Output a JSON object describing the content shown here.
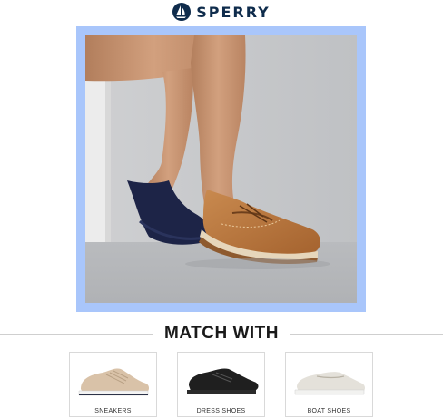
{
  "brand": {
    "name": "SPERRY",
    "logo_icon": "sailboat-icon",
    "color": "#0f2c4c"
  },
  "hero": {
    "frame_color": "#a9c6fb"
  },
  "section": {
    "title": "MATCH WITH"
  },
  "categories": [
    {
      "label": "SNEAKERS",
      "icon": "sneaker-icon"
    },
    {
      "label": "DRESS SHOES",
      "icon": "dress-shoe-icon"
    },
    {
      "label": "BOAT SHOES",
      "icon": "boat-shoe-icon"
    }
  ]
}
